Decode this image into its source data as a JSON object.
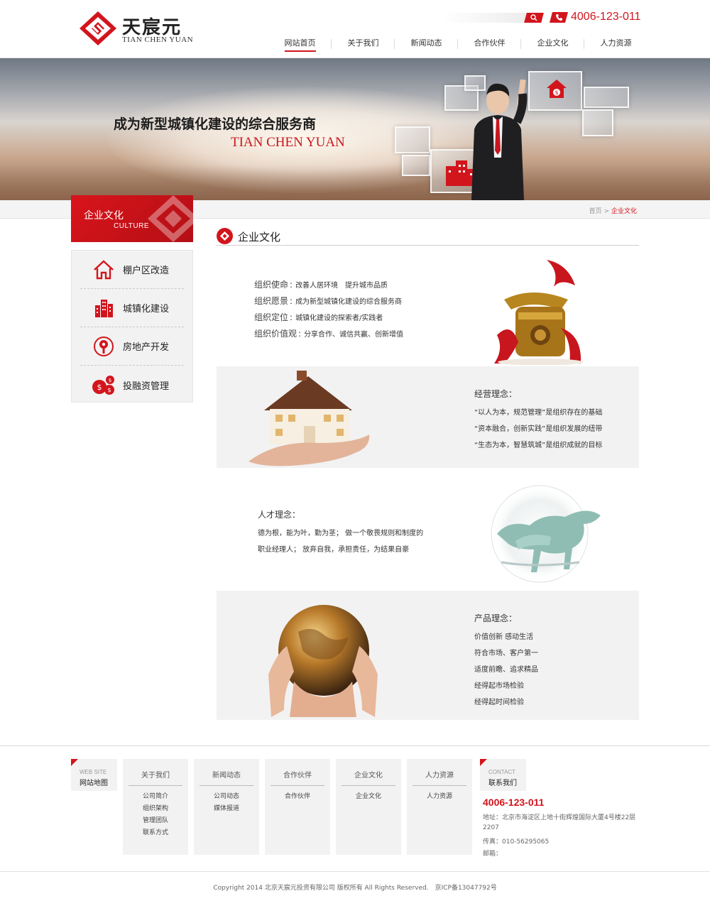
{
  "header": {
    "logo_cn": "天宸元",
    "logo_en": "TIAN CHEN YUAN",
    "search_placeholder": "",
    "phone": "4006-123-011",
    "nav": [
      "网站首页",
      "关于我们",
      "新闻动态",
      "合作伙伴",
      "企业文化",
      "人力资源"
    ],
    "active_nav": "网站首页"
  },
  "banner": {
    "title": "成为新型城镇化建设的综合服务商",
    "subtitle": "TIAN CHEN YUAN"
  },
  "breadcrumb": {
    "home": "首页",
    "separator": ">",
    "current": "企业文化"
  },
  "sidebar": {
    "title_cn": "企业文化",
    "title_en": "CULTURE",
    "items": [
      {
        "label": "棚户区改造",
        "icon": "house-icon"
      },
      {
        "label": "城镇化建设",
        "icon": "buildings-icon"
      },
      {
        "label": "房地产开发",
        "icon": "location-pin-icon"
      },
      {
        "label": "投融资管理",
        "icon": "coins-icon"
      }
    ]
  },
  "main": {
    "section_title": "企业文化",
    "org": [
      {
        "label": "组织使命",
        "value": "改善人居环境　提升城市品质"
      },
      {
        "label": "组织愿景",
        "value": "成为新型城镇化建设的综合服务商"
      },
      {
        "label": "组织定位",
        "value": "城镇化建设的探索者/实践者"
      },
      {
        "label": "组织价值观",
        "value": "分享合作、诚信共赢、创新增值"
      }
    ],
    "business": {
      "title": "经营理念：",
      "lines": [
        "“以人为本，规范管理”是组织存在的基础",
        "“资本融合，创新实践”是组织发展的纽带",
        "“生态为本，智慧筑城”是组织成就的目标"
      ]
    },
    "talent": {
      "title": "人才理念：",
      "lines": [
        "德为根，能为叶，勤为茎； 做一个敬畏规则和制度的",
        "职业经理人； 放弃自我，承担责任，为结果自豪"
      ]
    },
    "product": {
      "title": "产品理念：",
      "lines": [
        "价值创新 感动生活",
        "符合市场、客户第一",
        "适度前瞻、追求精品",
        "经得起市场检验",
        "经得起时间检验"
      ]
    }
  },
  "footer": {
    "sitemap_en": "WEB SITE",
    "sitemap_cn": "网站地图",
    "columns": [
      {
        "title": "关于我们",
        "links": [
          "公司简介",
          "组织架构",
          "管理团队",
          "联系方式"
        ]
      },
      {
        "title": "新闻动态",
        "links": [
          "公司动态",
          "媒体报道"
        ]
      },
      {
        "title": "合作伙伴",
        "links": [
          "合作伙伴"
        ]
      },
      {
        "title": "企业文化",
        "links": [
          "企业文化"
        ]
      },
      {
        "title": "人力资源",
        "links": [
          "人力资源"
        ]
      }
    ],
    "contact_en": "CONTACT",
    "contact_cn": "联系我们",
    "phone": "4006-123-011",
    "address_1": "地址：北京市海淀区上地十街辉煌国际大厦4号楼22层",
    "address_2": "2207",
    "fax": "传真：010-56295065",
    "email": "邮箱：",
    "copyright": "Copyright 2014 北京天宸元投资有限公司 版权所有 All Rights Reserved.　京ICP备13047792号"
  },
  "colors": {
    "brand_red": "#d2151d",
    "panel_grey": "#f2f2f2"
  }
}
